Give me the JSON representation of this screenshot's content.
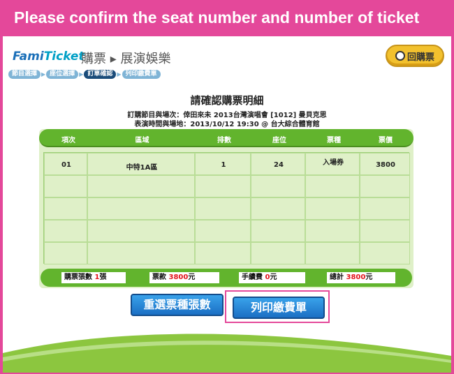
{
  "banner": {
    "title": "Please confirm the seat number and number of ticket"
  },
  "header": {
    "logo_famit": "Fami",
    "logo_ticket": "Ticket",
    "title": "購票 ▸ 展演娛樂",
    "steps": [
      "節目選擇",
      "座位選擇",
      "訂單確認",
      "列印繳費單"
    ],
    "active_step": 2,
    "back_label": "回購票"
  },
  "confirm": {
    "title": "請確認購票明細",
    "program_line": "訂購節目與場次：倖田來未 2013台灣演唱會 [1012] 曼貝克思",
    "time_line": "表演時間與場地：2013/10/12 19:30 @ 台大綜合體育館"
  },
  "table": {
    "columns": [
      "項次",
      "區域",
      "排數",
      "座位",
      "票種",
      "票價"
    ],
    "rows": [
      [
        "01",
        "中特1A區",
        "1",
        "24",
        "入場券",
        "3800"
      ],
      [
        "",
        "",
        "",
        "",
        "",
        ""
      ],
      [
        "",
        "",
        "",
        "",
        "",
        ""
      ],
      [
        "",
        "",
        "",
        "",
        "",
        ""
      ],
      [
        "",
        "",
        "",
        "",
        "",
        ""
      ]
    ]
  },
  "summary": {
    "count_label": "購票張數",
    "count_value": "1",
    "count_unit": "張",
    "price_label": "票款",
    "price_value": "3800",
    "price_unit": "元",
    "fee_label": "手續費",
    "fee_value": "0",
    "fee_unit": "元",
    "total_label": "總計",
    "total_value": "3800",
    "total_unit": "元"
  },
  "buttons": {
    "reselect": "重選票種張數",
    "print": "列印繳費單"
  },
  "colors": {
    "brand_pink": "#e4489a",
    "header_green": "#62b42d",
    "button_blue": "#1b6fc4",
    "accent_red": "#e3131b"
  }
}
